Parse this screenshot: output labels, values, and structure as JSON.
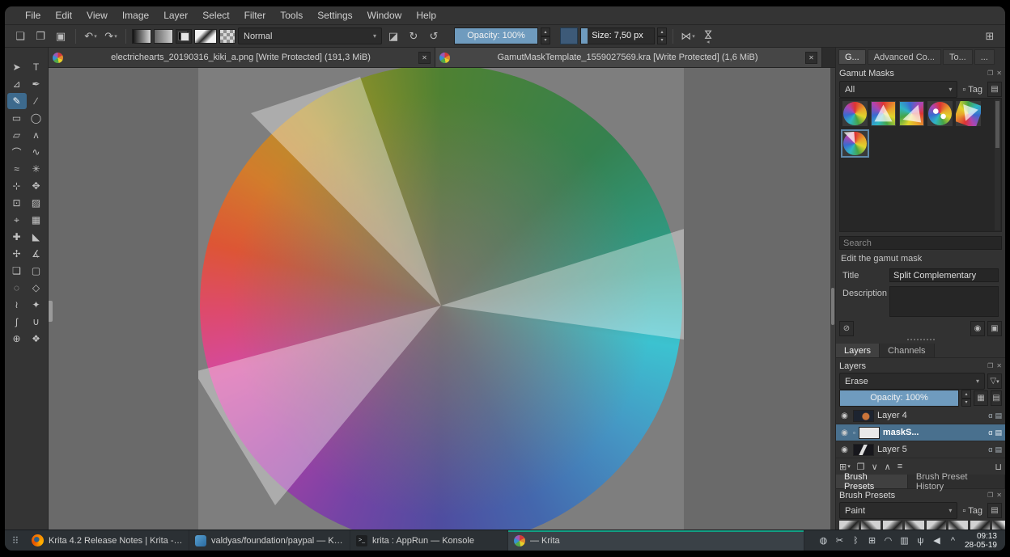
{
  "colors": {
    "accent_blue": "#6f9bbe",
    "selection_blue": "#49708e",
    "tool_highlight": "#3d6a8d",
    "active_task_teal": "#14a085"
  },
  "menubar": {
    "items": [
      "File",
      "Edit",
      "View",
      "Image",
      "Layer",
      "Select",
      "Filter",
      "Tools",
      "Settings",
      "Window",
      "Help"
    ]
  },
  "toolbar": {
    "blend_mode_value": "Normal",
    "opacity_label": "Opacity:  100%",
    "size_label": "Size:  7,50 px"
  },
  "doc_tabs": [
    {
      "title": "electrichearts_20190316_kiki_a.png [Write Protected]  (191,3 MiB)"
    },
    {
      "title": "GamutMaskTemplate_1559027569.kra [Write Protected]  (1,6 MiB)"
    }
  ],
  "gamut_docker": {
    "tabs": [
      "G...",
      "Advanced Co...",
      "To...",
      "..."
    ],
    "title": "Gamut Masks",
    "filter_value": "All",
    "tag_label": "Tag",
    "search_placeholder": "Search",
    "edit_section_label": "Edit the gamut mask",
    "title_label": "Title",
    "title_value": "Split Complementary",
    "description_label": "Description"
  },
  "layers_docker": {
    "tabs": [
      "Layers",
      "Channels"
    ],
    "title": "Layers",
    "blend_mode_value": "Erase",
    "opacity_label": "Opacity:  100%",
    "layers": [
      {
        "name": "Layer 4"
      },
      {
        "name": "maskS..."
      },
      {
        "name": "Layer 5"
      }
    ]
  },
  "brush_docker": {
    "tabs": [
      "Brush Presets",
      "Brush Preset History"
    ],
    "title": "Brush Presets",
    "filter_value": "Paint",
    "tag_label": "Tag"
  },
  "taskbar": {
    "tasks": [
      {
        "label": "Krita 4.2 Release Notes | Krita - ..."
      },
      {
        "label": "valdyas/foundation/paypal — KM..."
      },
      {
        "label": "krita : AppRun — Konsole"
      },
      {
        "label": "— Krita"
      }
    ],
    "clock_time": "09:13",
    "clock_date": "28-05-19"
  },
  "icons": {
    "new": "❏",
    "open": "❐",
    "save": "▣",
    "undo": "↶",
    "redo": "↷",
    "caret": "▾",
    "caret_up": "▴",
    "eraser": "◪",
    "reload": "↻",
    "reset": "↺",
    "mirror": "⋈",
    "workspace": "⊞",
    "close": "✕",
    "float": "❐",
    "menu": "▤",
    "tag_box": "▫",
    "funnel": "▽",
    "block": "⊘",
    "eye": "◉",
    "disk": "▣",
    "alpha": "α",
    "props": "▤",
    "add": "⊞",
    "duplicate": "❐",
    "move_down": "∨",
    "move_up": "∧",
    "properties": "≡",
    "trash": "⊔",
    "checker": "▦",
    "tool_select": "➤",
    "tool_text": "T",
    "tool_edit_shapes": "⊿",
    "tool_calligraphy": "✒",
    "tool_brush": "✎",
    "tool_line": "∕",
    "tool_rect": "▭",
    "tool_ellipse": "◯",
    "tool_polygon": "▱",
    "tool_polyline": "ʌ",
    "tool_bezier": "⌒",
    "tool_freehand_path": "∿",
    "tool_dynamic": "≈",
    "tool_multibrush": "✳",
    "tool_transform": "⊹",
    "tool_move": "✥",
    "tool_crop": "⊡",
    "tool_gradient": "▨",
    "tool_sampler": "⌖",
    "tool_pattern": "▦",
    "tool_patch": "✚",
    "tool_fill": "◣",
    "tool_assist": "✢",
    "tool_measure": "∡",
    "tool_reference": "❏",
    "tool_rect_sel": "▢",
    "tool_ellipse_sel": "◌",
    "tool_poly_sel": "◇",
    "tool_freehand_sel": "≀",
    "tool_similar_sel": "✦",
    "tool_bezier_sel": "ʃ",
    "tool_magnetic_sel": "∪",
    "tool_zoom": "⊕",
    "tool_pan": "❖",
    "launcher": "⠿",
    "konsole_glyph": ">_",
    "tray": [
      "◍",
      "✂",
      "ᛒ",
      "⊞",
      "◠",
      "▥",
      "ψ",
      "◀",
      "^"
    ]
  }
}
